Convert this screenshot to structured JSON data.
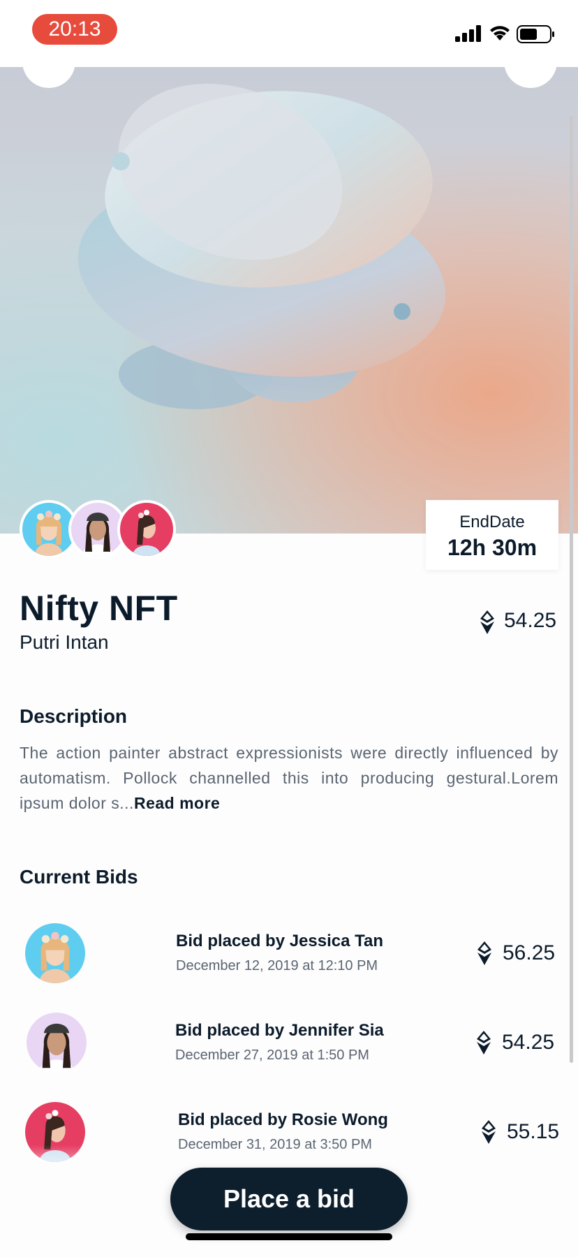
{
  "status_bar": {
    "time": "20:13"
  },
  "hero": {
    "image_alt": "abstract 3D discs artwork"
  },
  "end_date": {
    "label": "EndDate",
    "value": "12h 30m"
  },
  "nft": {
    "title": "Nifty NFT",
    "creator": "Putri Intan",
    "price": "54.25"
  },
  "description": {
    "heading": "Description",
    "text": "The action painter abstract expressionists were directly influenced by automatism. Pollock channelled this into producing gestural.Lorem ipsum dolor s...",
    "read_more": "Read more"
  },
  "bids": {
    "heading": "Current Bids",
    "items": [
      {
        "title": "Bid placed by Jessica Tan",
        "date": "December 12, 2019 at 12:10 PM",
        "amount": "56.25"
      },
      {
        "title": "Bid placed by Jennifer Sia",
        "date": "December 27, 2019 at 1:50 PM",
        "amount": "54.25"
      },
      {
        "title": "Bid placed by Rosie Wong",
        "date": "December 31, 2019 at 3:50 PM",
        "amount": "55.15"
      }
    ]
  },
  "cta": {
    "label": "Place a bid"
  },
  "colors": {
    "accent": "#0d1e2c",
    "time_pill": "#e74b3c",
    "avatar_blue": "#5fcdef",
    "avatar_lavender": "#e8d6f4",
    "avatar_red": "#e63e63"
  }
}
